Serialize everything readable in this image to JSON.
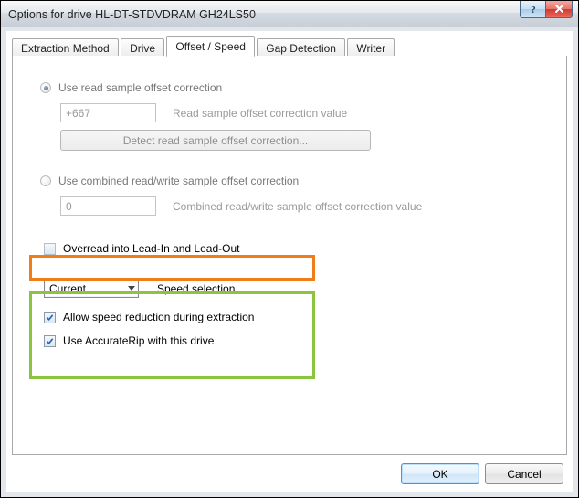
{
  "window": {
    "title": "Options for drive HL-DT-STDVDRAM GH24LS50"
  },
  "tabs": {
    "extraction": "Extraction Method",
    "drive": "Drive",
    "offset_speed": "Offset / Speed",
    "gap_detection": "Gap Detection",
    "writer": "Writer"
  },
  "offset": {
    "use_read_label": "Use read sample offset correction",
    "read_value": "+667",
    "read_value_label": "Read sample offset correction value",
    "detect_button": "Detect read sample offset correction...",
    "use_combined_label": "Use combined read/write sample offset correction",
    "combined_value": "0",
    "combined_value_label": "Combined read/write sample offset correction value",
    "overread_label": "Overread into Lead-In and Lead-Out"
  },
  "speed": {
    "selected": "Current",
    "label": "Speed selection",
    "allow_reduction": "Allow speed reduction during extraction",
    "use_accuraterip": "Use AccurateRip with this drive"
  },
  "buttons": {
    "ok": "OK",
    "cancel": "Cancel"
  }
}
